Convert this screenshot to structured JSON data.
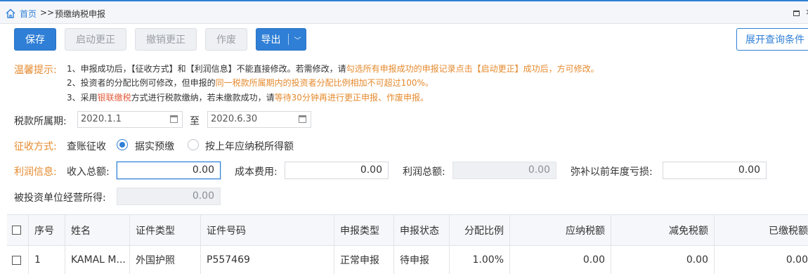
{
  "breadcrumb": {
    "home": "首页",
    "sep": ">>",
    "current": "预缴纳税申报"
  },
  "toolbar": {
    "save": "保存",
    "start_correction": "启动更正",
    "cancel_correction": "撤销更正",
    "void": "作废",
    "export": "导出",
    "expand_query": "展开查询条件"
  },
  "tips": {
    "label": "温馨提示:",
    "line1_a": "1、申报成功后，【征收方式】和【利润信息】不能直接修改。若需修改，请",
    "line1_b": "勾选所有申报成功的申报记录点击【启动更正】成功后，方可修改。",
    "line2_a": "2、投资者的分配比例可修改，但申报的",
    "line2_b": "同一税款所属期内的投资者分配比例相加不可超过100%。",
    "line3_a": "3、采用",
    "line3_b": "银联缴税",
    "line3_c": "方式进行税款缴纳，若未缴款成功，请",
    "line3_d": "等待30分钟再进行更正申报、作废申报。"
  },
  "period": {
    "label": "税款所属期:",
    "start": "2020.1.1",
    "to": "至",
    "end": "2020.6.30"
  },
  "collection": {
    "label": "征收方式:",
    "method": "查账征收",
    "option1": "据实预缴",
    "option2": "按上年应纳税所得额",
    "selected": "据实预缴"
  },
  "profit": {
    "label": "利润信息:",
    "total_income_label": "收入总额:",
    "total_income": "0.00",
    "cost_label": "成本费用:",
    "cost": "0.00",
    "total_profit_label": "利润总额:",
    "total_profit": "0.00",
    "loss_label": "弥补以前年度亏损:",
    "loss": "0.00",
    "investee_label": "被投资单位经营所得:",
    "investee": "0.00"
  },
  "table": {
    "headers": [
      "序号",
      "姓名",
      "证件类型",
      "证件号码",
      "申报类型",
      "申报状态",
      "分配比例",
      "应纳税额",
      "减免税额",
      "已缴税额"
    ],
    "rows": [
      {
        "index": "1",
        "name": "KAMAL M...",
        "id_type": "外国护照",
        "id_number": "P557469",
        "report_type": "正常申报",
        "status": "待申报",
        "ratio": "1.00%",
        "tax_payable": "0.00",
        "tax_relief": "0.00",
        "tax_paid": "0.00"
      }
    ]
  },
  "colors": {
    "accent": "#2f7fd6",
    "orange": "#e58a2e"
  }
}
